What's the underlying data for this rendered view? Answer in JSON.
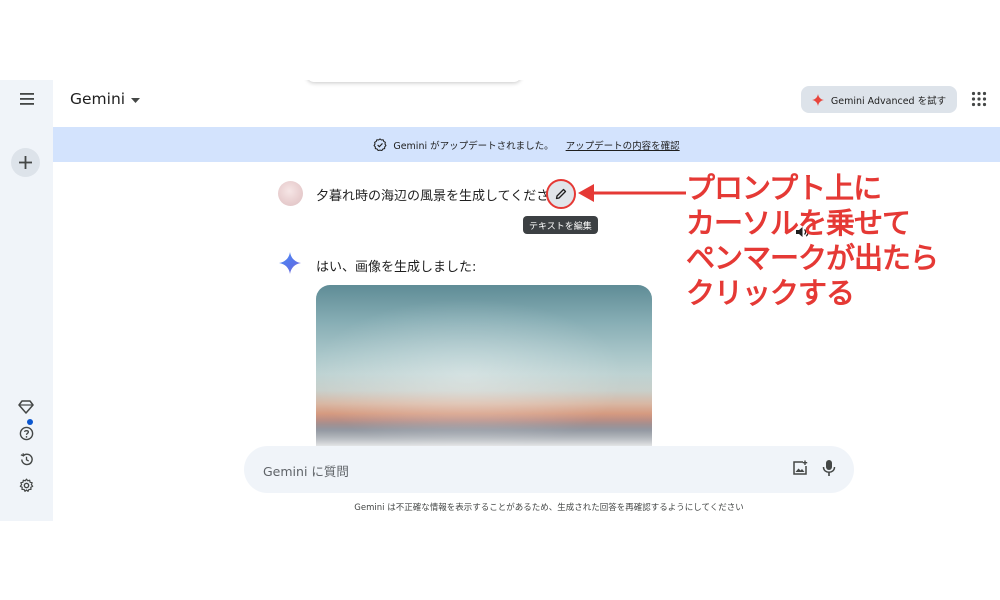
{
  "app": {
    "model_name": "Gemini",
    "advanced_button": "Gemini Advanced を試す"
  },
  "banner": {
    "text": "Gemini がアップデートされました。",
    "link": "アップデートの内容を確認"
  },
  "conversation": {
    "prompt": "夕暮れ時の海辺の風景を生成してください",
    "edit_tooltip": "テキストを編集",
    "response": "はい、画像を生成しました:"
  },
  "input": {
    "placeholder": "Gemini に質問"
  },
  "footer": {
    "disclaimer": "Gemini は不正確な情報を表示することがあるため、生成された回答を再確認するようにしてください"
  },
  "annotation": {
    "lines": [
      "プロンプト上に",
      "カーソルを乗せて",
      "ペンマークが出たら",
      "クリックする"
    ],
    "color": "#e53935"
  },
  "colors": {
    "sidebar_bg": "#f0f4f9",
    "banner_bg": "#d3e3fd",
    "accent_blue": "#0b57d0",
    "gemini_spark_red": "#e8453c"
  },
  "icons": {
    "menu": "menu-icon",
    "new_chat": "plus-icon",
    "gems": "gem-icon",
    "help": "help-icon",
    "activity": "history-icon",
    "settings": "gear-icon",
    "apps": "apps-grid-icon",
    "edit": "pencil-icon",
    "speaker": "speaker-icon",
    "image_upload": "image-upload-icon",
    "mic": "mic-icon"
  }
}
